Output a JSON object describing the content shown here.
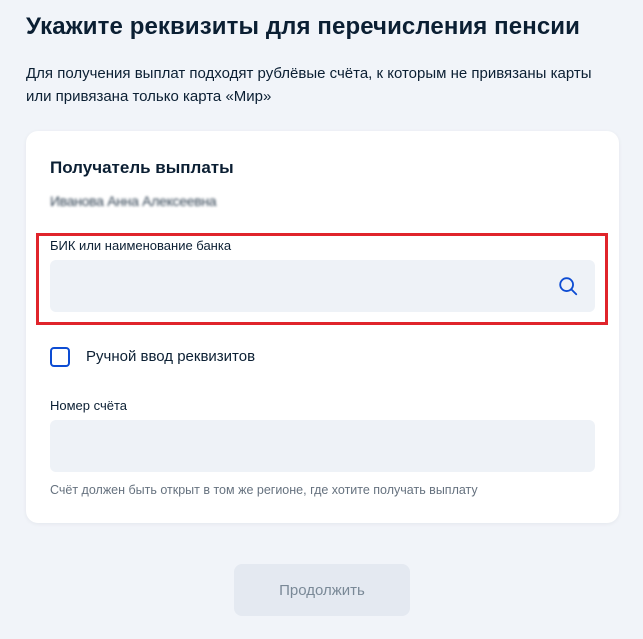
{
  "page": {
    "title": "Укажите реквизиты для перечисления пенсии",
    "subtitle": "Для получения выплат подходят рублёвые счёта, к которым не привязаны карты или привязана только карта «Мир»"
  },
  "recipient": {
    "section_title": "Получатель выплаты",
    "name": "Иванова Анна Алексеевна"
  },
  "bank": {
    "label": "БИК или наименование банка",
    "value": "",
    "search_icon": "search-icon",
    "highlight_color": "#e0242b"
  },
  "manual_entry": {
    "label": "Ручной ввод реквизитов",
    "checked": false
  },
  "account": {
    "label": "Номер счёта",
    "value": "",
    "hint": "Счёт должен быть открыт в том же регионе, где хотите получать выплату"
  },
  "actions": {
    "continue_label": "Продолжить",
    "continue_enabled": false
  },
  "colors": {
    "accent": "#0d4cd3",
    "page_bg": "#f1f4f9",
    "field_bg": "#eef2f7",
    "text": "#0b1f33",
    "hint_text": "#66727f",
    "button_disabled_bg": "#e4e9f1"
  }
}
